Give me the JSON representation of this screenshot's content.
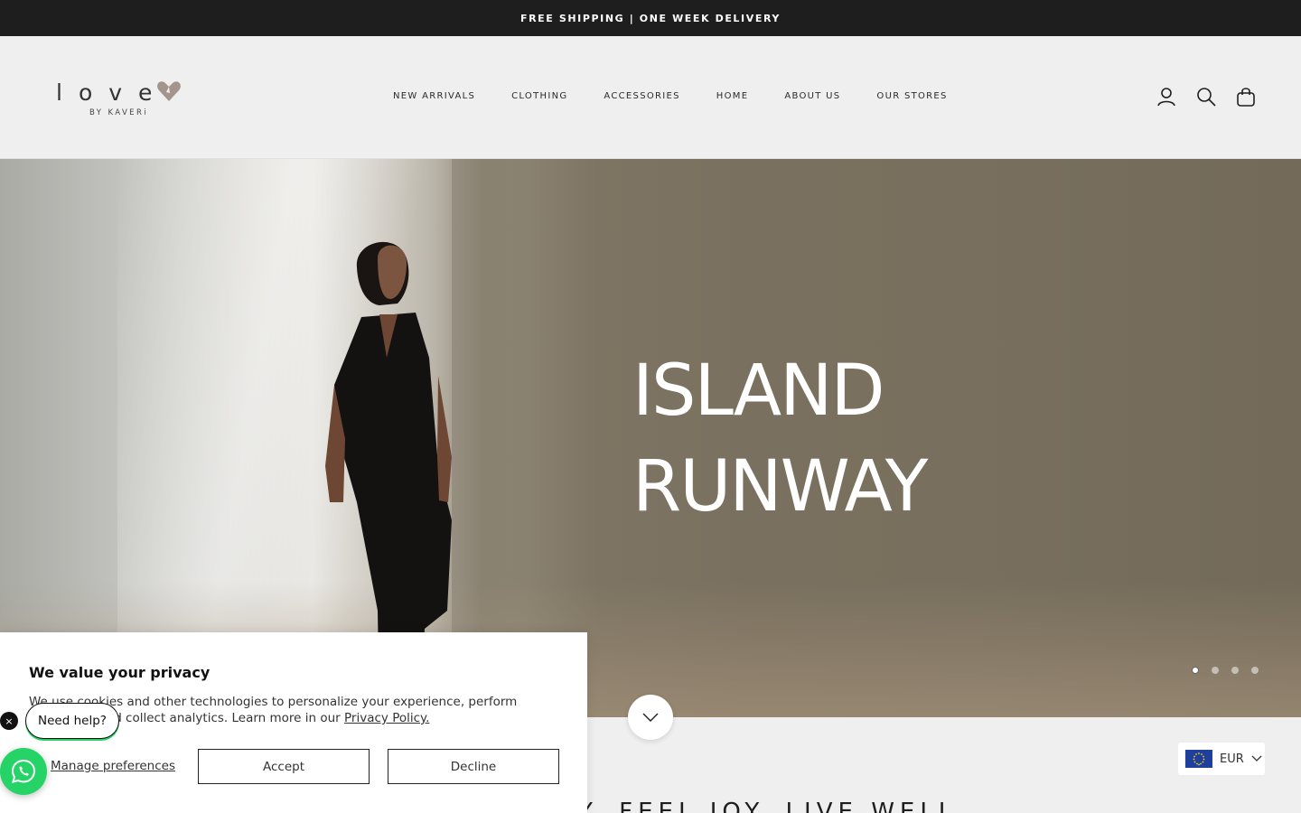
{
  "announcement": {
    "text": "FREE SHIPPING | ONE WEEK DELIVERY"
  },
  "logo": {
    "word": "love",
    "sub": "BY KAVERi"
  },
  "nav": {
    "items": [
      {
        "label": "NEW ARRIVALS"
      },
      {
        "label": "CLOTHING"
      },
      {
        "label": "ACCESSORIES"
      },
      {
        "label": "HOME"
      },
      {
        "label": "ABOUT US"
      },
      {
        "label": "OUR STORES"
      }
    ]
  },
  "header_icons": [
    "account-icon",
    "search-icon",
    "cart-icon"
  ],
  "hero": {
    "title_line1": "ISLAND",
    "title_line2": "RUNWAY",
    "slide_count": 4,
    "active_slide": 1
  },
  "tagline": "Y. FEEL JOY. LIVE WELL",
  "currency": {
    "code": "EUR",
    "flag": "eu-flag-icon"
  },
  "privacy": {
    "title": "We value your privacy",
    "body": "We use cookies and other technologies to personalize your experience, perform marketing, and collect analytics. Learn more in our ",
    "link": "Privacy Policy.",
    "manage": "Manage preferences",
    "accept": "Accept",
    "decline": "Decline"
  },
  "help": {
    "label": "Need help?",
    "close": "×"
  },
  "colors": {
    "topbar": "#1e1e1e",
    "whatsapp": "#25d366",
    "page": "#efefef"
  }
}
